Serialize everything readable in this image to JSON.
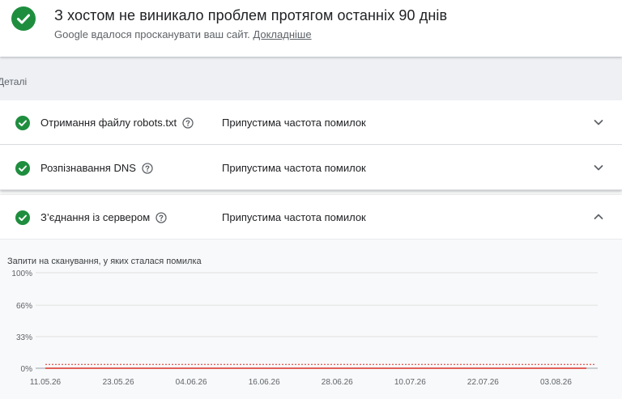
{
  "header": {
    "title": "З хостом не виникало проблем протягом останніх 90 днів",
    "subtitle": "Google вдалося просканувати ваш сайт.",
    "learn_more": "Докладніше"
  },
  "details": {
    "label": "Деталі"
  },
  "rows": [
    {
      "name": "Отримання файлу robots.txt",
      "status": "Припустима частота помилок",
      "expanded": false
    },
    {
      "name": "Розпізнавання DNS",
      "status": "Припустима частота помилок",
      "expanded": false
    },
    {
      "name": "З’єднання із сервером",
      "status": "Припустима частота помилок",
      "expanded": true
    }
  ],
  "colors": {
    "success": "#1e8e3e",
    "line": "#d93025",
    "threshold": "#d93025",
    "grid": "#e0e0e0"
  },
  "chart_data": {
    "type": "line",
    "title": "Запити на сканування, у яких сталася помилка",
    "y_ticks": [
      "100%",
      "66%",
      "33%",
      "0%"
    ],
    "y_tick_values": [
      100,
      66,
      33,
      0
    ],
    "ylim": [
      0,
      100
    ],
    "x_tick_labels": [
      "11.05.26",
      "23.05.26",
      "04.06.26",
      "16.06.26",
      "28.06.26",
      "10.07.26",
      "22.07.26",
      "03.08.26"
    ],
    "x_tick_index": [
      0,
      12,
      24,
      36,
      48,
      60,
      72,
      84
    ],
    "points_count": 90,
    "series": [
      {
        "values_all": 0
      }
    ],
    "threshold": 4,
    "grid": true
  }
}
